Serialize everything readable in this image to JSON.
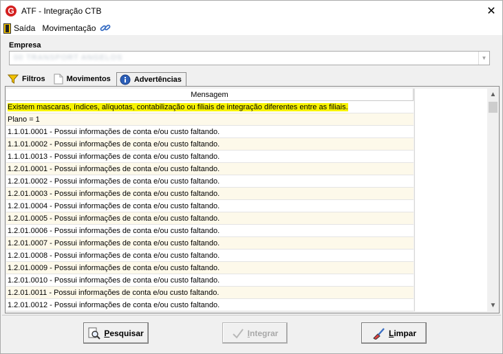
{
  "window": {
    "title": "ATF - Integração CTB",
    "close_glyph": "✕"
  },
  "menu": [
    {
      "label": "Saída",
      "icon": "exit-door-icon"
    },
    {
      "label": "Movimentação",
      "icon": "chain-link-icon"
    }
  ],
  "empresa": {
    "label": "Empresa",
    "value": "00 TRANSPORT ANGELOS"
  },
  "tabs": [
    {
      "label": "Filtros",
      "icon": "funnel-icon",
      "active": false
    },
    {
      "label": "Movimentos",
      "icon": "document-icon",
      "active": false
    },
    {
      "label": "Advertências",
      "icon": "info-icon",
      "active": true
    }
  ],
  "grid": {
    "header": "Mensagem",
    "rows": [
      "Existem mascaras, índices, alíquotas, contabilização ou filiais de integração diferentes entre as filiais.",
      "Plano = 1",
      "1.1.01.0001 - Possui informações de conta e/ou custo faltando.",
      "1.1.01.0002 - Possui informações de conta e/ou custo faltando.",
      "1.1.01.0013 - Possui informações de conta e/ou custo faltando.",
      "1.2.01.0001 - Possui informações de conta e/ou custo faltando.",
      "1.2.01.0002 - Possui informações de conta e/ou custo faltando.",
      "1.2.01.0003 - Possui informações de conta e/ou custo faltando.",
      "1.2.01.0004 - Possui informações de conta e/ou custo faltando.",
      "1.2.01.0005 - Possui informações de conta e/ou custo faltando.",
      "1.2.01.0006 - Possui informações de conta e/ou custo faltando.",
      "1.2.01.0007 - Possui informações de conta e/ou custo faltando.",
      "1.2.01.0008 - Possui informações de conta e/ou custo faltando.",
      "1.2.01.0009 - Possui informações de conta e/ou custo faltando.",
      "1.2.01.0010 - Possui informações de conta e/ou custo faltando.",
      "1.2.01.0011 - Possui informações de conta e/ou custo faltando.",
      "1.2.01.0012 - Possui informações de conta e/ou custo faltando."
    ]
  },
  "buttons": {
    "pesquisar": "Pesquisar",
    "integrar": "Integrar",
    "limpar": "Limpar"
  },
  "colors": {
    "warning_highlight": "#f7f300",
    "alt_row": "#fdf9ea",
    "brand_red": "#d42020"
  }
}
